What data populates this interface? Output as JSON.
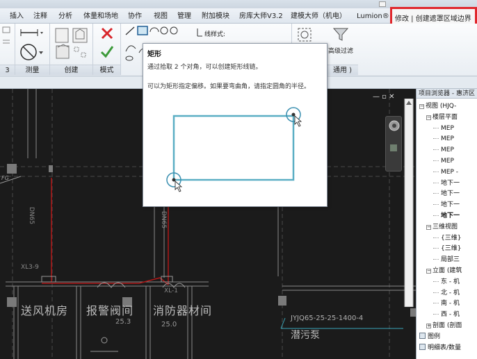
{
  "tabs": {
    "insert": "插入",
    "annotate": "注释",
    "analyze": "分析",
    "massing": "体量和场地",
    "collaborate": "协作",
    "view": "视图",
    "manage": "管理",
    "addins": "附加模块",
    "fangku": "房库大师V3.2",
    "jianmo": "建模大师（机电）",
    "lumion": "Lumion®",
    "modify": "修改 | 创建遮罩区域边界"
  },
  "ribbon": {
    "measure_label": "测量",
    "create_label": "创建",
    "mode_label": "模式",
    "linestyle_label": "线样式:",
    "advanced_filter": "高级过滤",
    "general_label": "通用 )"
  },
  "tooltip": {
    "title": "矩形",
    "line1": "通过拾取 2 个对角，可以创建矩形线链。",
    "line2": "可以为矩形指定偏移。如果要弯曲角，请指定圆角的半径。"
  },
  "canvas": {
    "view_controls": "— ▫ ✕",
    "labels": {
      "room1": "送风机房",
      "room2": "报警阀间",
      "room3": "消防器材间",
      "area1": "25.3",
      "area2": "25.0",
      "pump": "潜污泵",
      "pipe_tag": "JYJQ65-25-25-1400-4",
      "dn1": "DN65",
      "dn2": "DN65",
      "xl1": "XL3-9",
      "xl2": "XL-1",
      "mark": "FG"
    }
  },
  "browser": {
    "title": "项目浏览器 - 惠济区",
    "items": [
      {
        "label": "视图 (HJQ-",
        "depth": 0,
        "toggle": "−"
      },
      {
        "label": "楼层平面",
        "depth": 1,
        "toggle": "−"
      },
      {
        "label": "MEP",
        "depth": 2
      },
      {
        "label": "MEP",
        "depth": 2
      },
      {
        "label": "MEP",
        "depth": 2
      },
      {
        "label": "MEP",
        "depth": 2
      },
      {
        "label": "MEP -",
        "depth": 2
      },
      {
        "label": "地下一",
        "depth": 2
      },
      {
        "label": "地下一",
        "depth": 2
      },
      {
        "label": "地下一",
        "depth": 2
      },
      {
        "label": "地下一",
        "depth": 2,
        "bold": true
      },
      {
        "label": "三维视图",
        "depth": 1,
        "toggle": "−"
      },
      {
        "label": "{三维}",
        "depth": 2
      },
      {
        "label": "{三维}",
        "depth": 2
      },
      {
        "label": "局部三",
        "depth": 2
      },
      {
        "label": "立面 (建筑",
        "depth": 1,
        "toggle": "−"
      },
      {
        "label": "东 - 机",
        "depth": 2
      },
      {
        "label": "北 - 机",
        "depth": 2
      },
      {
        "label": "南 - 机",
        "depth": 2
      },
      {
        "label": "西 - 机",
        "depth": 2
      },
      {
        "label": "剖面 (剖面",
        "depth": 1,
        "toggle": "+"
      },
      {
        "label": "图例",
        "depth": 0
      },
      {
        "label": "明细表/数量",
        "depth": 0
      }
    ]
  },
  "colors": {
    "highlight_red": "#e0262b",
    "rect_cyan": "#5aaec4",
    "canvas_bg": "#1b1b1b"
  }
}
